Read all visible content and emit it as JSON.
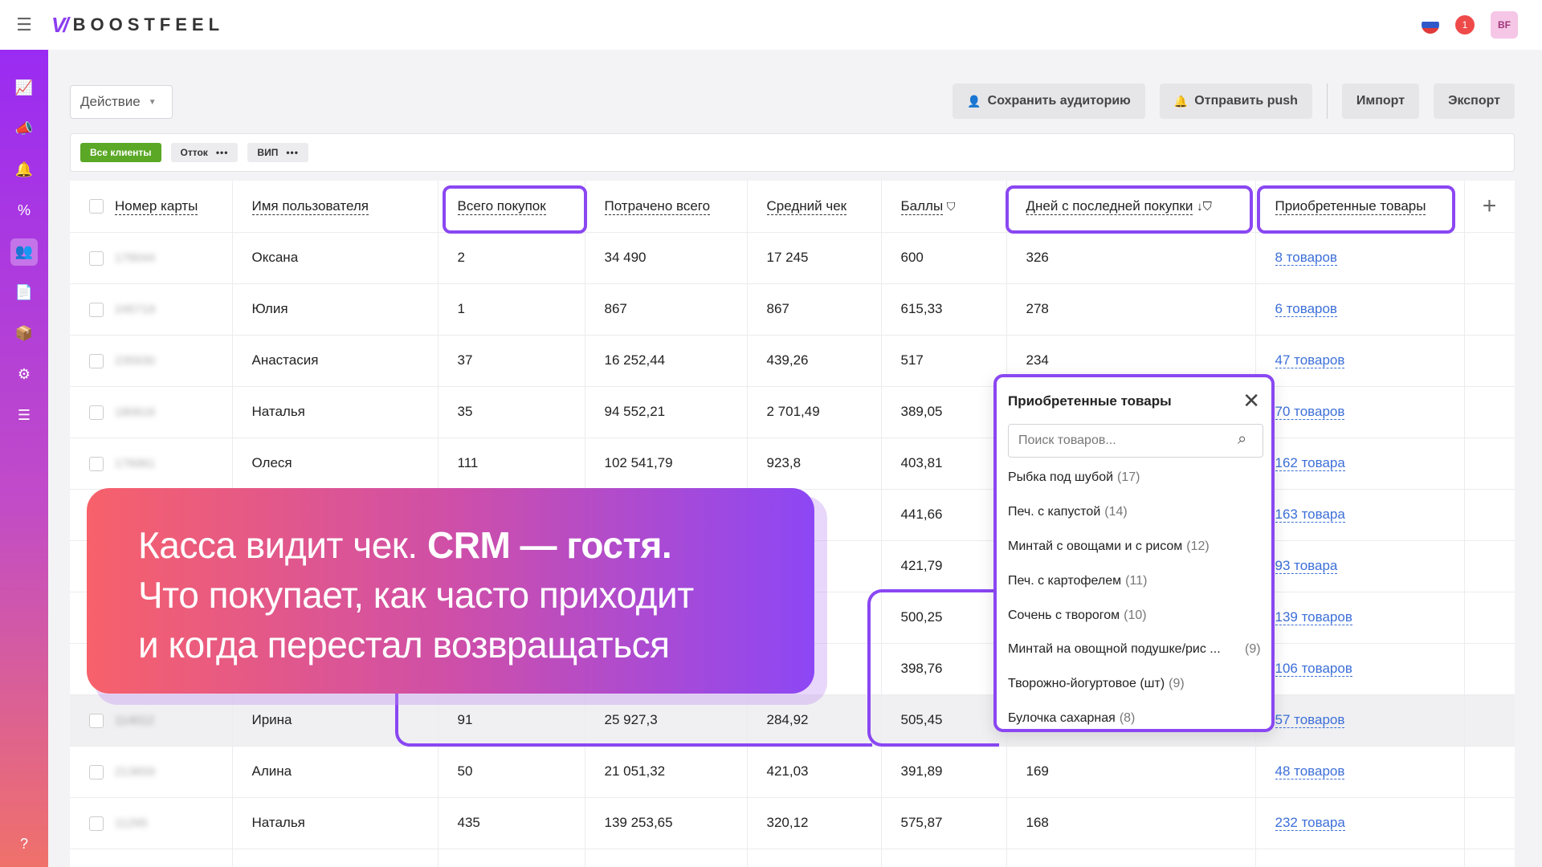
{
  "app": {
    "logo_mark": "V/",
    "logo_text": "BOOSTFEEL",
    "notification_count": "1",
    "avatar_initials": "BF",
    "brand_color": "#8a47f2"
  },
  "sidebar": {
    "items": [
      {
        "icon": "chart-icon",
        "glyph": "📈"
      },
      {
        "icon": "megaphone-icon",
        "glyph": "📣"
      },
      {
        "icon": "bell-icon",
        "glyph": "🔔"
      },
      {
        "icon": "percent-icon",
        "glyph": "%"
      },
      {
        "icon": "users-icon",
        "glyph": "👥",
        "active": true
      },
      {
        "icon": "document-icon",
        "glyph": "📄"
      },
      {
        "icon": "box-icon",
        "glyph": "📦"
      },
      {
        "icon": "settings-icon",
        "glyph": "⚙"
      },
      {
        "icon": "sliders-icon",
        "glyph": "☰"
      }
    ],
    "help_icon": "?"
  },
  "toolbar": {
    "action_label": "Действие",
    "save_audience": "Сохранить аудиторию",
    "send_push": "Отправить push",
    "import": "Импорт",
    "export": "Экспорт"
  },
  "segments": [
    {
      "label": "Все клиенты",
      "active": true
    },
    {
      "label": "Отток",
      "active": false,
      "menu": "•••"
    },
    {
      "label": "ВИП",
      "active": false,
      "menu": "•••"
    }
  ],
  "table": {
    "columns": {
      "card": "Номер карты",
      "name": "Имя пользователя",
      "purchases": "Всего покупок",
      "spent": "Потрачено всего",
      "avg": "Средний чек",
      "points": "Баллы",
      "points_filter": "⛉",
      "days": "Дней с последней покупки",
      "days_sort": "↓⛉",
      "goods": "Приобретенные товары",
      "add": "+"
    },
    "rows": [
      {
        "card": "179044",
        "name": "Оксана",
        "purchases": "2",
        "spent": "34 490",
        "avg": "17 245",
        "points": "600",
        "days": "326",
        "goods": "8 товаров"
      },
      {
        "card": "245719",
        "name": "Юлия",
        "purchases": "1",
        "spent": "867",
        "avg": "867",
        "points": "615,33",
        "days": "278",
        "goods": "6 товаров"
      },
      {
        "card": "235930",
        "name": "Анастасия",
        "purchases": "37",
        "spent": "16 252,44",
        "avg": "439,26",
        "points": "517",
        "days": "234",
        "goods": "47 товаров"
      },
      {
        "card": "180616",
        "name": "Наталья",
        "purchases": "35",
        "spent": "94 552,21",
        "avg": "2 701,49",
        "points": "389,05",
        "days": "",
        "goods": "70 товаров"
      },
      {
        "card": "176961",
        "name": "Олеся",
        "purchases": "111",
        "spent": "102 541,79",
        "avg": "923,8",
        "points": "403,81",
        "days": "",
        "goods": "162 товара"
      },
      {
        "card": "",
        "name": "",
        "purchases": "",
        "spent": "",
        "avg": "",
        "points": "441,66",
        "days": "",
        "goods": "163 товара"
      },
      {
        "card": "",
        "name": "",
        "purchases": "",
        "spent": "",
        "avg": "",
        "points": "421,79",
        "days": "",
        "goods": "93 товара"
      },
      {
        "card": "",
        "name": "",
        "purchases": "",
        "spent": "",
        "avg": "",
        "points": "500,25",
        "days": "",
        "goods": "139 товаров"
      },
      {
        "card": "",
        "name": "",
        "purchases": "",
        "spent": "",
        "avg": "",
        "points": "398,76",
        "days": "",
        "goods": "106 товаров"
      },
      {
        "card": "114012",
        "name": "Ирина",
        "purchases": "91",
        "spent": "25 927,3",
        "avg": "284,92",
        "points": "505,45",
        "days": "",
        "goods": "57 товаров",
        "highlight": true
      },
      {
        "card": "213659",
        "name": "Алина",
        "purchases": "50",
        "spent": "21 051,32",
        "avg": "421,03",
        "points": "391,89",
        "days": "169",
        "goods": "48 товаров"
      },
      {
        "card": "11295",
        "name": "Наталья",
        "purchases": "435",
        "spent": "139 253,65",
        "avg": "320,12",
        "points": "575,87",
        "days": "168",
        "goods": "232 товара"
      },
      {
        "card": "",
        "name": "",
        "purchases": "",
        "spent": "",
        "avg": "",
        "points": "",
        "days": "",
        "goods": ""
      }
    ]
  },
  "popover": {
    "title": "Приобретенные товары",
    "search_placeholder": "Поиск товаров...",
    "items": [
      {
        "name": "Рыбка под шубой",
        "count": "(17)"
      },
      {
        "name": "Печ. с капустой",
        "count": "(14)"
      },
      {
        "name": "Минтай с овощами и с рисом",
        "count": "(12)"
      },
      {
        "name": "Печ. с картофелем",
        "count": "(11)"
      },
      {
        "name": "Сочень с творогом",
        "count": "(10)"
      },
      {
        "name": "Минтай на овощной подушке/рис ...",
        "count": "(9)"
      },
      {
        "name": "Творожно-йогуртовое (шт)",
        "count": "(9)"
      },
      {
        "name": "Булочка сахарная",
        "count": "(8)"
      }
    ]
  },
  "banner": {
    "line1_regular": "Касса видит чек. ",
    "line1_bold": "CRM — гостя.",
    "line2": "Что покупает, как часто приходит",
    "line3": "и когда перестал возвращаться"
  }
}
